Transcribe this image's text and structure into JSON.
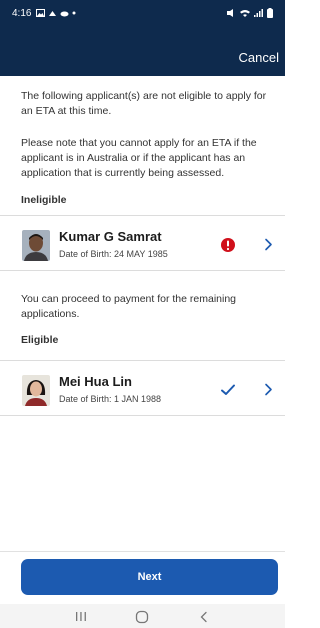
{
  "status_bar": {
    "time": "4:16",
    "notification_icons": [
      "image-icon",
      "cloud-icon",
      "cloud-icon",
      "dot-icon"
    ],
    "right_icons": [
      "mute-icon",
      "wifi-icon",
      "signal-icon",
      "battery-icon"
    ]
  },
  "header": {
    "cancel_label": "Cancel"
  },
  "message": {
    "not_eligible": "The following applicant(s) are not eligible to apply for an ETA at this time.",
    "note": "Please note that you cannot apply for an ETA if the applicant is in Australia or if the applicant has an application that is currently being assessed.",
    "proceed": "You can proceed to payment for the remaining applications."
  },
  "sections": {
    "ineligible_label": "Ineligible",
    "eligible_label": "Eligible"
  },
  "ineligible_applicant": {
    "name": "Kumar G Samrat",
    "dob": "Date of Birth: 24 MAY 1985",
    "status_icon": "error-icon"
  },
  "eligible_applicant": {
    "name": "Mei Hua Lin",
    "dob": "Date of Birth: 1 JAN 1988",
    "status_icon": "check-icon"
  },
  "footer": {
    "next_label": "Next"
  },
  "colors": {
    "header_bg": "#0e2a4d",
    "primary_button": "#1c5ab0",
    "error": "#d0101b",
    "check": "#1c5ab0"
  }
}
